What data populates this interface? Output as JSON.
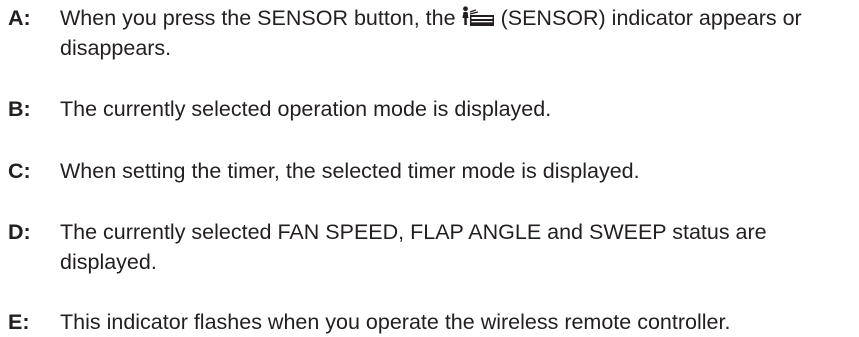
{
  "items": [
    {
      "letter": "A:",
      "text_before_icon": "When you press the SENSOR button, the",
      "icon": "sensor-indicator-icon",
      "text_after_icon": "(SENSOR) indicator appears or disappears."
    },
    {
      "letter": "B:",
      "text": "The currently selected operation mode is displayed."
    },
    {
      "letter": "C:",
      "text": "When setting the timer, the selected timer mode is displayed."
    },
    {
      "letter": "D:",
      "text": "The currently selected FAN SPEED, FLAP ANGLE and SWEEP status are displayed."
    },
    {
      "letter": "E:",
      "text": "This indicator flashes when you operate the wireless remote controller."
    }
  ]
}
